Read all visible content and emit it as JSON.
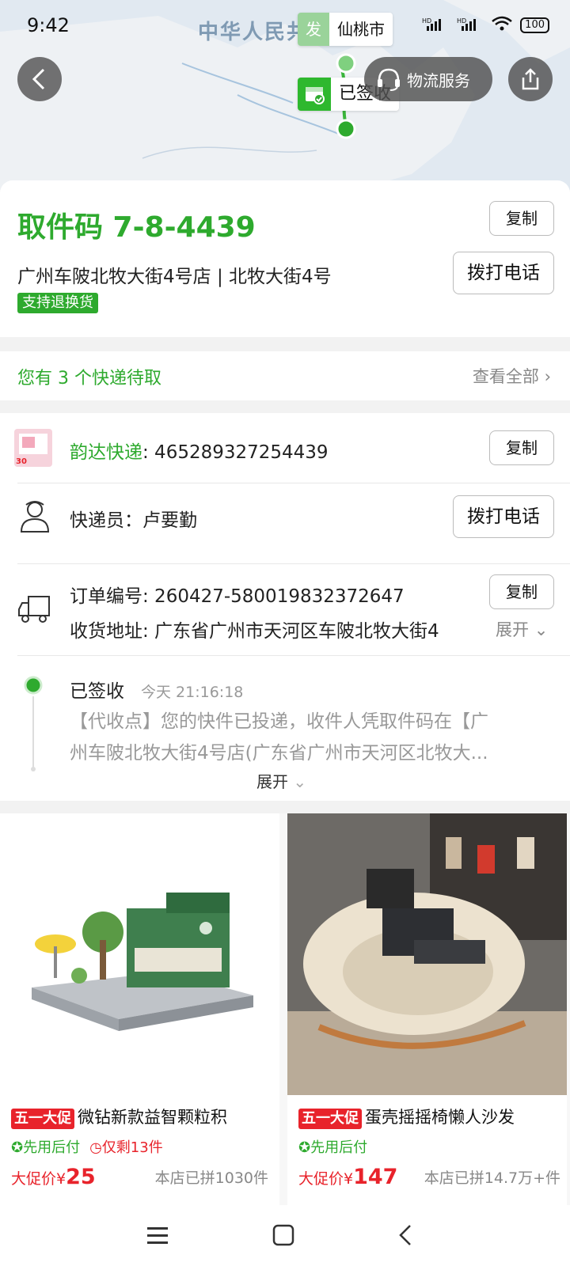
{
  "status_bar": {
    "time": "9:42",
    "network": "HD",
    "battery": "100"
  },
  "map": {
    "region_label": "中华人民共",
    "origin_tag": "发",
    "origin_city": "仙桃市",
    "signed_label": "已签收"
  },
  "top_buttons": {
    "logistics_service": "物流服务"
  },
  "pickup": {
    "code_label": "取件码 7-8-4439",
    "copy_label": "复制",
    "store_address": "广州车陂北牧大街4号店 | 北牧大街4号",
    "call_label": "拨打电话",
    "return_badge": "支持退换货"
  },
  "pending": {
    "text": "您有 3 个快递待取",
    "view_all": "查看全部"
  },
  "courier": {
    "carrier_name": "韵达快递",
    "tracking_number": ": 465289327254439",
    "copy_label": "复制",
    "courier_label": "快递员：卢要勤",
    "call_label": "拨打电话",
    "order_label": "订单编号: 260427-580019832372647",
    "order_copy_label": "复制",
    "address_label": "收货地址: 广东省广州市天河区车陂北牧大街4",
    "expand_label": "展开"
  },
  "timeline": {
    "status": "已签收",
    "time": "今天 21:16:18",
    "detail_line1": "【代收点】您的快件已投递，收件人凭取件码在【广",
    "detail_line2": "州车陂北牧大街4号店(广东省广州市天河区北牧大...",
    "expand_label": "展开"
  },
  "products": [
    {
      "promo": "五一大促",
      "title": "微钻新款益智颗粒积",
      "tag_pay": "先用后付",
      "tag_left": "仅剩13件",
      "price_label": "大促价¥",
      "price": "25",
      "sold": "本店已拼1030件"
    },
    {
      "promo": "五一大促",
      "title": "蛋壳摇摇椅懒人沙发",
      "tag_pay": "先用后付",
      "tag_left": "",
      "price_label": "大促价¥",
      "price": "147",
      "sold": "本店已拼14.7万+件"
    }
  ],
  "colors": {
    "green": "#2eaa2e",
    "red": "#e8232b"
  }
}
